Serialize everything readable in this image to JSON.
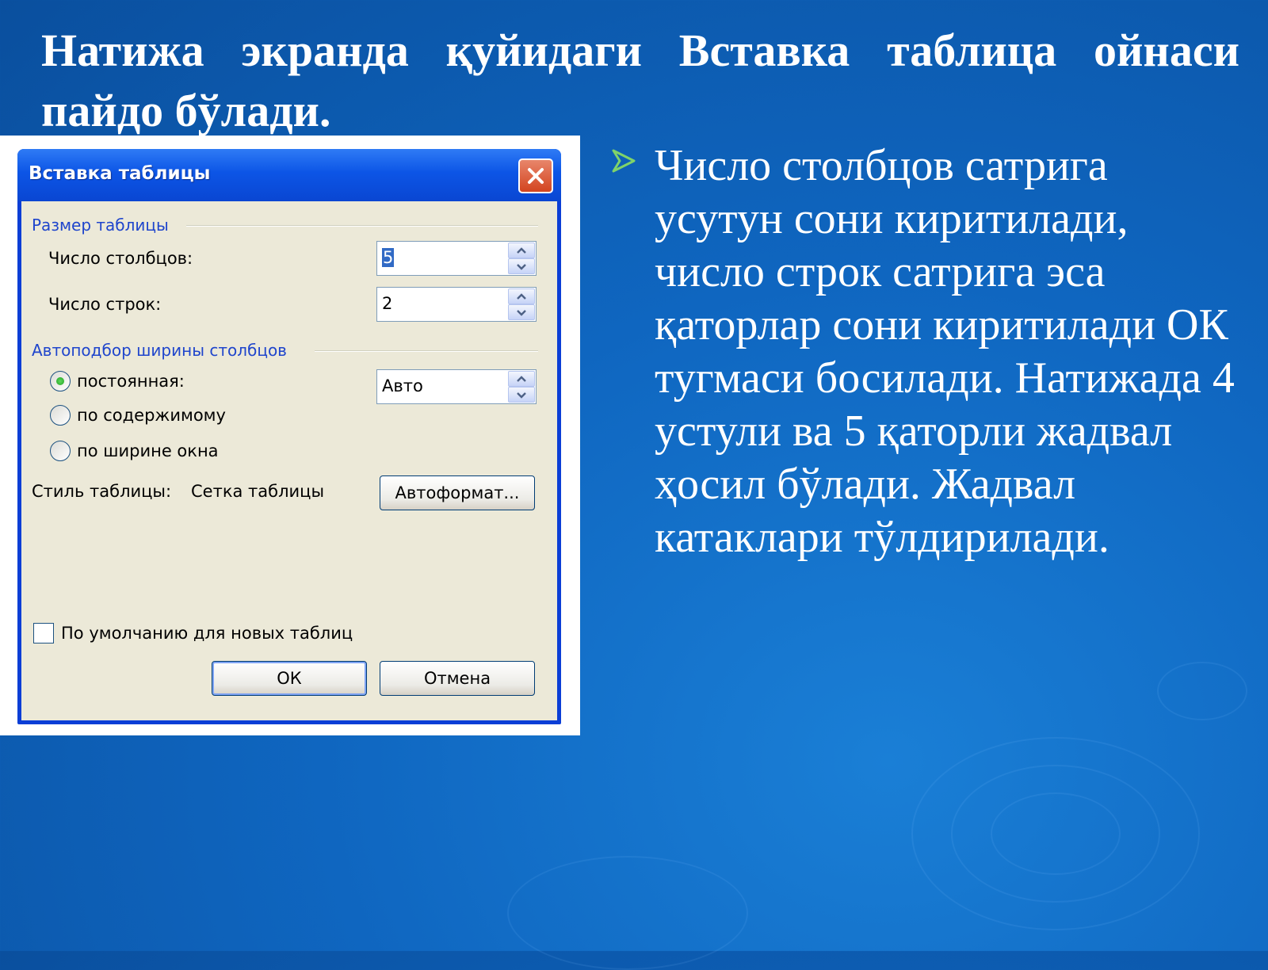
{
  "slide": {
    "title": "Натижа экранда қуйидаги Вставка таблица ойнаси пайдо бўлади.",
    "bullet_text": "Число столбцов сатрига усутун сони киритилади, число строк сатрига эса қаторлар сони киритилади ОК тугмаси босилади. Натижада 4 устули ва 5 қаторли жадвал ҳосил бўлади. Жадвал катаклари тўлдирилади."
  },
  "dialog": {
    "title": "Вставка таблицы",
    "table_size": {
      "group_label": "Размер таблицы",
      "columns_label": "Число столбцов:",
      "columns_value": "5",
      "rows_label": "Число строк:",
      "rows_value": "2"
    },
    "autofit": {
      "group_label": "Автоподбор ширины столбцов",
      "fixed_label": "постоянная:",
      "fixed_value": "Авто",
      "content_label": "по содержимому",
      "window_label": "по ширине окна",
      "selected": "fixed"
    },
    "style": {
      "label": "Стиль таблицы:",
      "value": "Сетка таблицы",
      "autoformat_button": "Автоформат..."
    },
    "default_checkbox_label": "По умолчанию для новых таблиц",
    "default_checked": false,
    "ok_button": "ОК",
    "cancel_button": "Отмена"
  },
  "colors": {
    "background": "#0f66c0",
    "titlebar": "#0c55e6",
    "dialog_client": "#ece9d8",
    "group_label": "#1f45cc",
    "bullet_arrow": "#7fd36a"
  },
  "icons": {
    "close": "close-icon",
    "spin_up": "chevron-up-icon",
    "spin_down": "chevron-down-icon",
    "bullet": "arrow-bullet-icon"
  }
}
